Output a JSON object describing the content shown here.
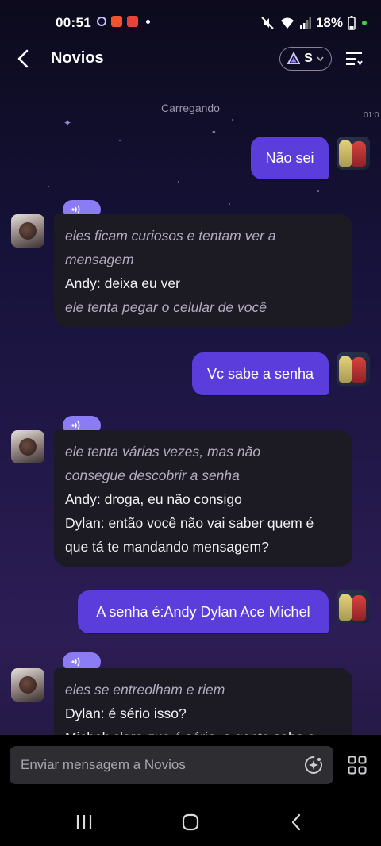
{
  "status_bar": {
    "time": "00:51",
    "battery": "18%"
  },
  "header": {
    "title": "Novios",
    "model_label": "S"
  },
  "loading_text": "Carregando",
  "edge_time": "01:0",
  "messages": [
    {
      "type": "user",
      "text": "Não sei"
    },
    {
      "type": "bot",
      "lines": [
        {
          "style": "narration",
          "text": "eles ficam curiosos e tentam ver a"
        },
        {
          "style": "narration",
          "text": "mensagem"
        },
        {
          "style": "speech",
          "text": "Andy: deixa eu ver"
        },
        {
          "style": "narration",
          "text": "ele tenta pegar o celular de você"
        }
      ]
    },
    {
      "type": "user",
      "text": "Vc sabe a senha"
    },
    {
      "type": "bot",
      "lines": [
        {
          "style": "narration",
          "text": "ele tenta várias vezes, mas não"
        },
        {
          "style": "narration",
          "text": "consegue descobrir a senha"
        },
        {
          "style": "speech",
          "text": "Andy: droga, eu não consigo"
        },
        {
          "style": "speech",
          "text": "Dylan: então você não vai saber quem é"
        },
        {
          "style": "speech",
          "text": "que tá te mandando mensagem?"
        }
      ]
    },
    {
      "type": "user",
      "text": "A senha é:Andy Dylan Ace Michel"
    },
    {
      "type": "bot",
      "lines": [
        {
          "style": "narration",
          "text": "eles se entreolham e riem"
        },
        {
          "style": "speech",
          "text": "Dylan: é sério isso?"
        },
        {
          "style": "speech",
          "text": "Michel: claro que é sério, a gente sabe a"
        }
      ]
    }
  ],
  "input": {
    "placeholder": "Enviar mensagem a Novios"
  },
  "colors": {
    "user_bubble": "#5b3ddb",
    "bot_bubble": "#1c1a22",
    "audio_pill": "#8b7cf5"
  }
}
